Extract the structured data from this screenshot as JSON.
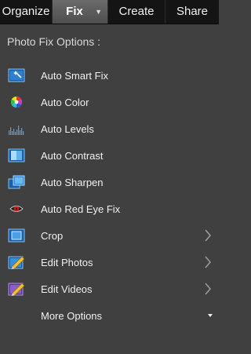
{
  "tabs": [
    {
      "label": "Organize",
      "active": false
    },
    {
      "label": "Fix",
      "active": true
    },
    {
      "label": "Create",
      "active": false
    },
    {
      "label": "Share",
      "active": false
    }
  ],
  "panel": {
    "title": "Photo Fix Options :"
  },
  "items": [
    {
      "label": "Auto Smart Fix",
      "icon": "auto-smart-fix-icon"
    },
    {
      "label": "Auto Color",
      "icon": "color-wheel-icon"
    },
    {
      "label": "Auto Levels",
      "icon": "histogram-icon"
    },
    {
      "label": "Auto Contrast",
      "icon": "contrast-icon"
    },
    {
      "label": "Auto Sharpen",
      "icon": "sharpen-icon"
    },
    {
      "label": "Auto Red Eye Fix",
      "icon": "red-eye-icon"
    },
    {
      "label": "Crop",
      "icon": "crop-icon",
      "submenu": true
    },
    {
      "label": "Edit Photos",
      "icon": "edit-photos-icon",
      "submenu": true
    },
    {
      "label": "Edit Videos",
      "icon": "edit-videos-icon",
      "submenu": true
    },
    {
      "label": "More Options",
      "dropdown": true
    }
  ],
  "colors": {
    "background": "#404040",
    "tab_bar": "#141414",
    "active_tab": "#5a5a5a",
    "text": "#f0f0f0",
    "icon_blue": "#3a8fd8"
  }
}
